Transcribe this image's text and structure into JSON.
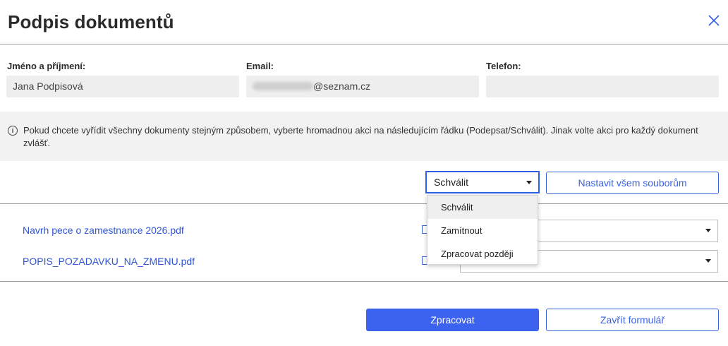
{
  "dialog": {
    "title": "Podpis dokumentů",
    "close_icon": "close-icon"
  },
  "fields": {
    "name": {
      "label": "Jméno a příjmení:",
      "value": "Jana Podpisová"
    },
    "email": {
      "label": "Email:",
      "value": "@seznam.cz"
    },
    "phone": {
      "label": "Telefon:",
      "value": ""
    }
  },
  "info": {
    "icon": "info-icon",
    "text": "Pokud chcete vyřídit všechny dokumenty stejným způsobem, vyberte hromadnou akci na následujícím řádku (Podepsat/Schválit). Jinak volte akci pro každý dokument zvlášť."
  },
  "bulk": {
    "selected": "Schválit",
    "apply_label": "Nastavit všem souborům",
    "options": [
      "Schválit",
      "Zamítnout",
      "Zpracovat později"
    ],
    "highlighted": "Schválit"
  },
  "documents": [
    {
      "name": "Navrh pece o zamestnance 2026.pdf",
      "action": ""
    },
    {
      "name": "POPIS_POZADAVKU_NA_ZMENU.pdf",
      "action": ""
    }
  ],
  "footer": {
    "submit_label": "Zpracovat",
    "close_label": "Zavřít formulář"
  },
  "colors": {
    "accent": "#3b63f0",
    "link": "#2f55d4",
    "info_bg": "#f2f2f2",
    "input_bg": "#eeeeee"
  }
}
